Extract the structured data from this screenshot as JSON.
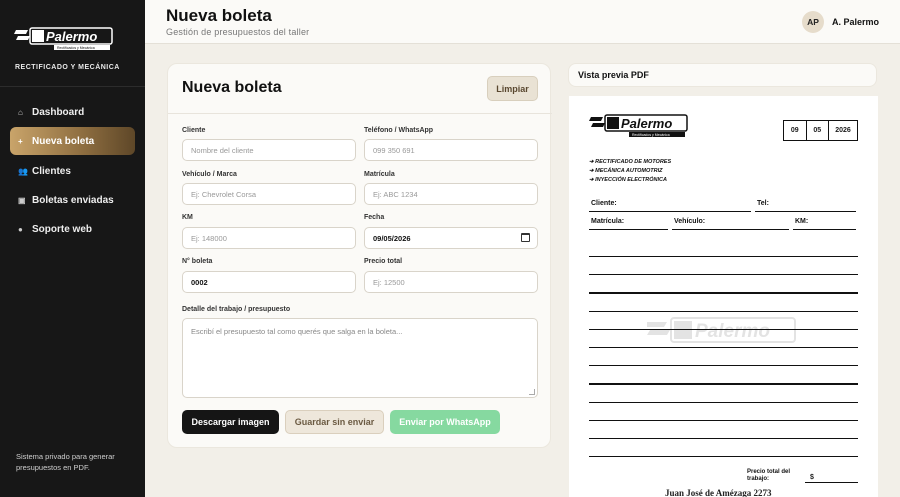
{
  "sidebar": {
    "brand_logo_text": "Palermo",
    "brand_logo_sub": "Rectificados y Mecánica",
    "brand_subtitle": "RECTIFICADO Y MECÁNICA",
    "items": [
      {
        "label": "Dashboard",
        "icon": "home-icon"
      },
      {
        "label": "Nueva boleta",
        "icon": "plus-icon"
      },
      {
        "label": "Clientes",
        "icon": "users-icon"
      },
      {
        "label": "Boletas enviadas",
        "icon": "box-icon"
      },
      {
        "label": "Soporte web",
        "icon": "dot-icon"
      }
    ],
    "footer": "Sistema privado para generar presupuestos en PDF."
  },
  "header": {
    "title": "Nueva boleta",
    "subtitle": "Gestión de presupuestos del taller",
    "avatar_initials": "AP",
    "user_name": "A. Palermo"
  },
  "form": {
    "title": "Nueva boleta",
    "clear_label": "Limpiar",
    "fields": {
      "cliente": {
        "label": "Cliente",
        "placeholder": "Nombre del cliente"
      },
      "telefono": {
        "label": "Teléfono / WhatsApp",
        "placeholder": "099 350 691"
      },
      "vehiculo": {
        "label": "Vehículo / Marca",
        "placeholder": "Ej: Chevrolet Corsa"
      },
      "matricula": {
        "label": "Matrícula",
        "placeholder": "Ej: ABC 1234"
      },
      "km": {
        "label": "KM",
        "placeholder": "Ej: 148000"
      },
      "fecha": {
        "label": "Fecha",
        "value": "09/05/2026"
      },
      "boleta": {
        "label": "N° boleta",
        "value": "0002"
      },
      "precio": {
        "label": "Precio total",
        "placeholder": "Ej: 12500"
      },
      "detalle": {
        "label": "Detalle del trabajo / presupuesto",
        "placeholder": "Escribí el presupuesto tal como querés que salga en la boleta..."
      }
    },
    "buttons": {
      "download": "Descargar imagen",
      "save": "Guardar sin enviar",
      "whatsapp": "Enviar por WhatsApp"
    }
  },
  "preview": {
    "title": "Vista previa PDF",
    "date": {
      "day": "09",
      "month": "05",
      "year": "2026"
    },
    "services": [
      "➔ RECTIFICADO DE MOTORES",
      "➔ MECÁNICA AUTOMOTRIZ",
      "➔ INYECCIÓN ELECTRÓNICA"
    ],
    "labels": {
      "cliente": "Cliente:",
      "tel": "Tel:",
      "matricula": "Matrícula:",
      "vehiculo": "Vehículo:",
      "km": "KM:",
      "precio_total": "Precio total del trabajo:",
      "currency": "$"
    },
    "address": "Juan José de Amézaga 2273"
  },
  "colors": {
    "sidebar_bg": "#171717",
    "accent_gold": "#c9a46a",
    "whatsapp_green": "#86d9a0",
    "page_bg": "#f2efe8"
  }
}
